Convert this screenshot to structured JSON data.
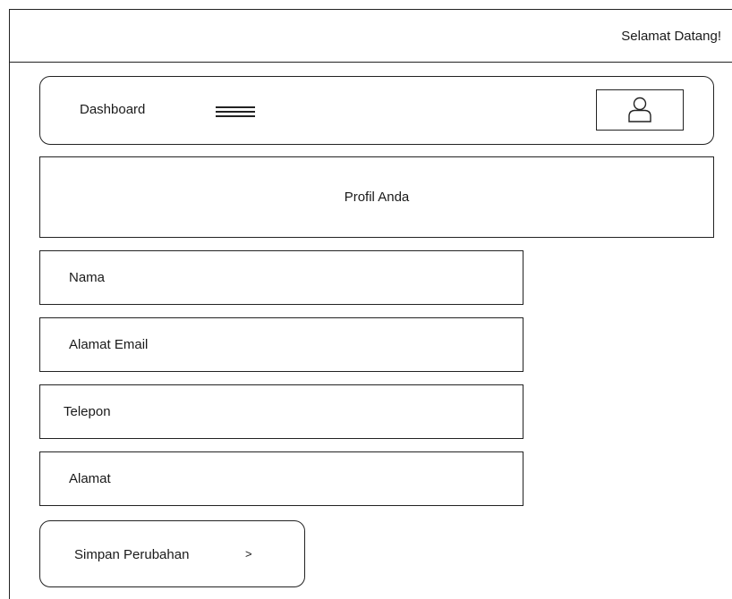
{
  "header": {
    "welcome_text": "Selamat Datang!"
  },
  "navbar": {
    "title": "Dashboard",
    "menu_icon": "hamburger-menu-icon",
    "profile_icon": "user-icon"
  },
  "profile": {
    "title": "Profil Anda"
  },
  "form": {
    "fields": [
      {
        "label": "Nama"
      },
      {
        "label": "Alamat Email"
      },
      {
        "label": "Telepon"
      },
      {
        "label": "Alamat"
      }
    ],
    "submit_label": "Simpan Perubahan",
    "submit_arrow": ">"
  }
}
